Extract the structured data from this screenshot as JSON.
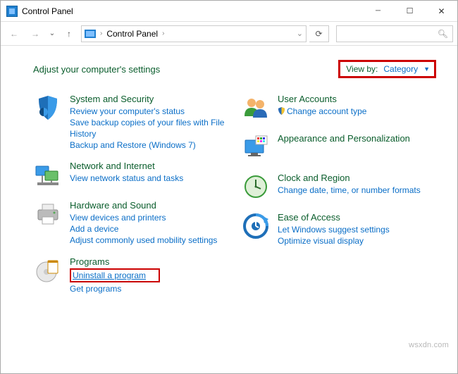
{
  "window": {
    "title": "Control Panel"
  },
  "breadcrumb": {
    "root": "Control Panel"
  },
  "heading": "Adjust your computer's settings",
  "viewby": {
    "label": "View by:",
    "value": "Category"
  },
  "categories": {
    "left": [
      {
        "title": "System and Security",
        "links": [
          "Review your computer's status",
          "Save backup copies of your files with File History",
          "Backup and Restore (Windows 7)"
        ]
      },
      {
        "title": "Network and Internet",
        "links": [
          "View network status and tasks"
        ]
      },
      {
        "title": "Hardware and Sound",
        "links": [
          "View devices and printers",
          "Add a device",
          "Adjust commonly used mobility settings"
        ]
      },
      {
        "title": "Programs",
        "highlight_link": "Uninstall a program",
        "links": [
          "Get programs"
        ]
      }
    ],
    "right": [
      {
        "title": "User Accounts",
        "links": [
          "Change account type"
        ],
        "icon_link": true
      },
      {
        "title": "Appearance and Personalization",
        "links": []
      },
      {
        "title": "Clock and Region",
        "links": [
          "Change date, time, or number formats"
        ]
      },
      {
        "title": "Ease of Access",
        "links": [
          "Let Windows suggest settings",
          "Optimize visual display"
        ]
      }
    ]
  },
  "watermark": "wsxdn.com"
}
